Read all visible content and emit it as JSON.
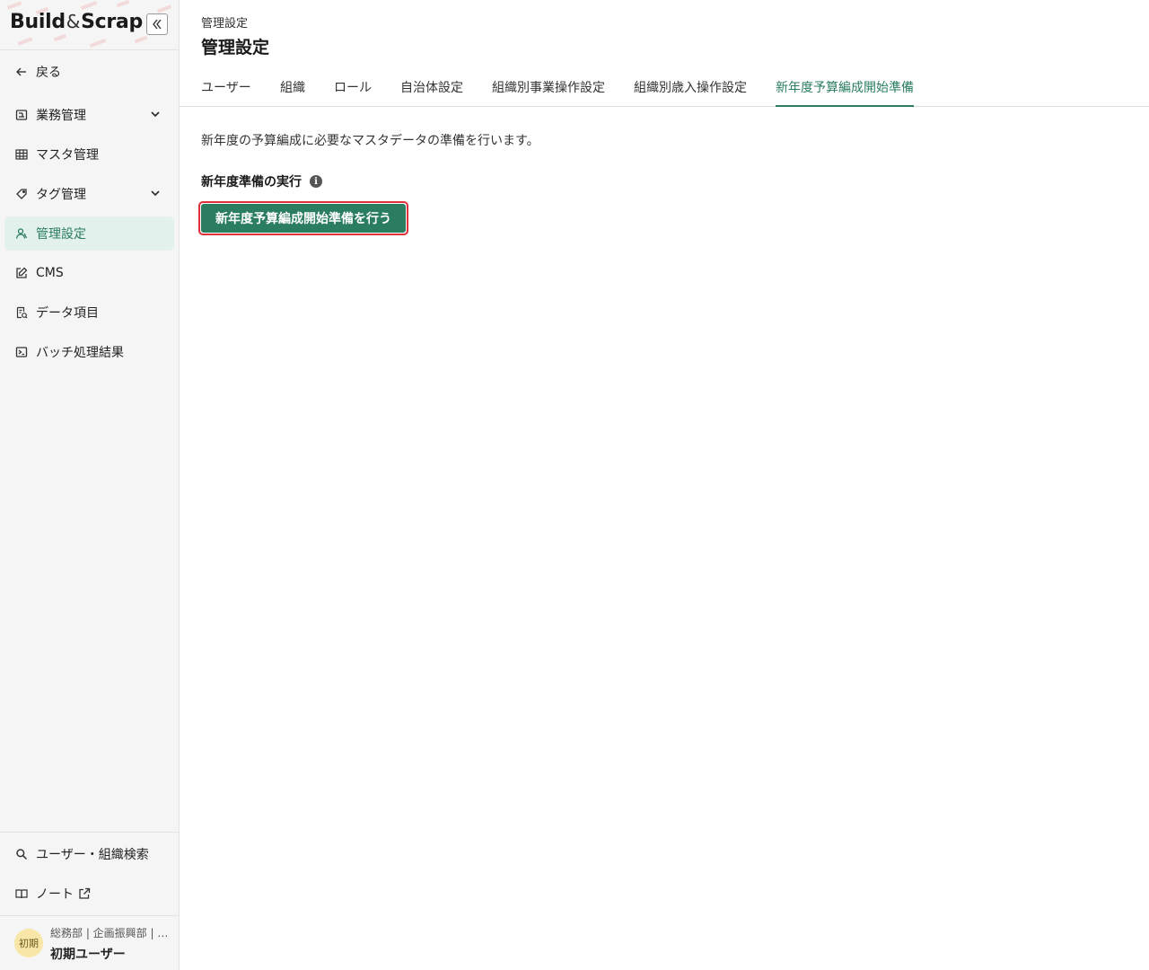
{
  "app": {
    "logo_left": "Build",
    "logo_amp": "&",
    "logo_right": "Scrap",
    "collapse_icon": "double-chevron-left-icon"
  },
  "sidebar": {
    "back_label": "戻る",
    "items": [
      {
        "label": "業務管理",
        "icon": "ledger-icon",
        "expandable": true
      },
      {
        "label": "マスタ管理",
        "icon": "table-icon",
        "expandable": false
      },
      {
        "label": "タグ管理",
        "icon": "tag-icon",
        "expandable": true
      },
      {
        "label": "管理設定",
        "icon": "people-icon",
        "expandable": false,
        "active": true
      },
      {
        "label": "CMS",
        "icon": "edit-icon",
        "expandable": false
      },
      {
        "label": "データ項目",
        "icon": "document-icon",
        "expandable": false
      },
      {
        "label": "バッチ処理結果",
        "icon": "terminal-icon",
        "expandable": false
      }
    ],
    "bottom_items": [
      {
        "label": "ユーザー・組織検索",
        "icon": "search-icon"
      },
      {
        "label": "ノート",
        "icon": "book-icon",
        "external": true
      }
    ],
    "user": {
      "avatar_text": "初期",
      "org": "総務部 | 企画振興部 | …",
      "name": "初期ユーザー"
    }
  },
  "header": {
    "breadcrumb": "管理設定",
    "title": "管理設定"
  },
  "tabs": [
    {
      "label": "ユーザー"
    },
    {
      "label": "組織"
    },
    {
      "label": "ロール"
    },
    {
      "label": "自治体設定"
    },
    {
      "label": "組織別事業操作設定"
    },
    {
      "label": "組織別歳入操作設定"
    },
    {
      "label": "新年度予算編成開始準備",
      "active": true
    }
  ],
  "content": {
    "description": "新年度の予算編成に必要なマスタデータの準備を行います。",
    "section_title": "新年度準備の実行",
    "action_button": "新年度予算編成開始準備を行う"
  },
  "colors": {
    "accent": "#2a7d60",
    "active_bg": "#e3f1ec",
    "focus_ring": "#e0303a",
    "avatar_bg": "#f7e6a7"
  }
}
